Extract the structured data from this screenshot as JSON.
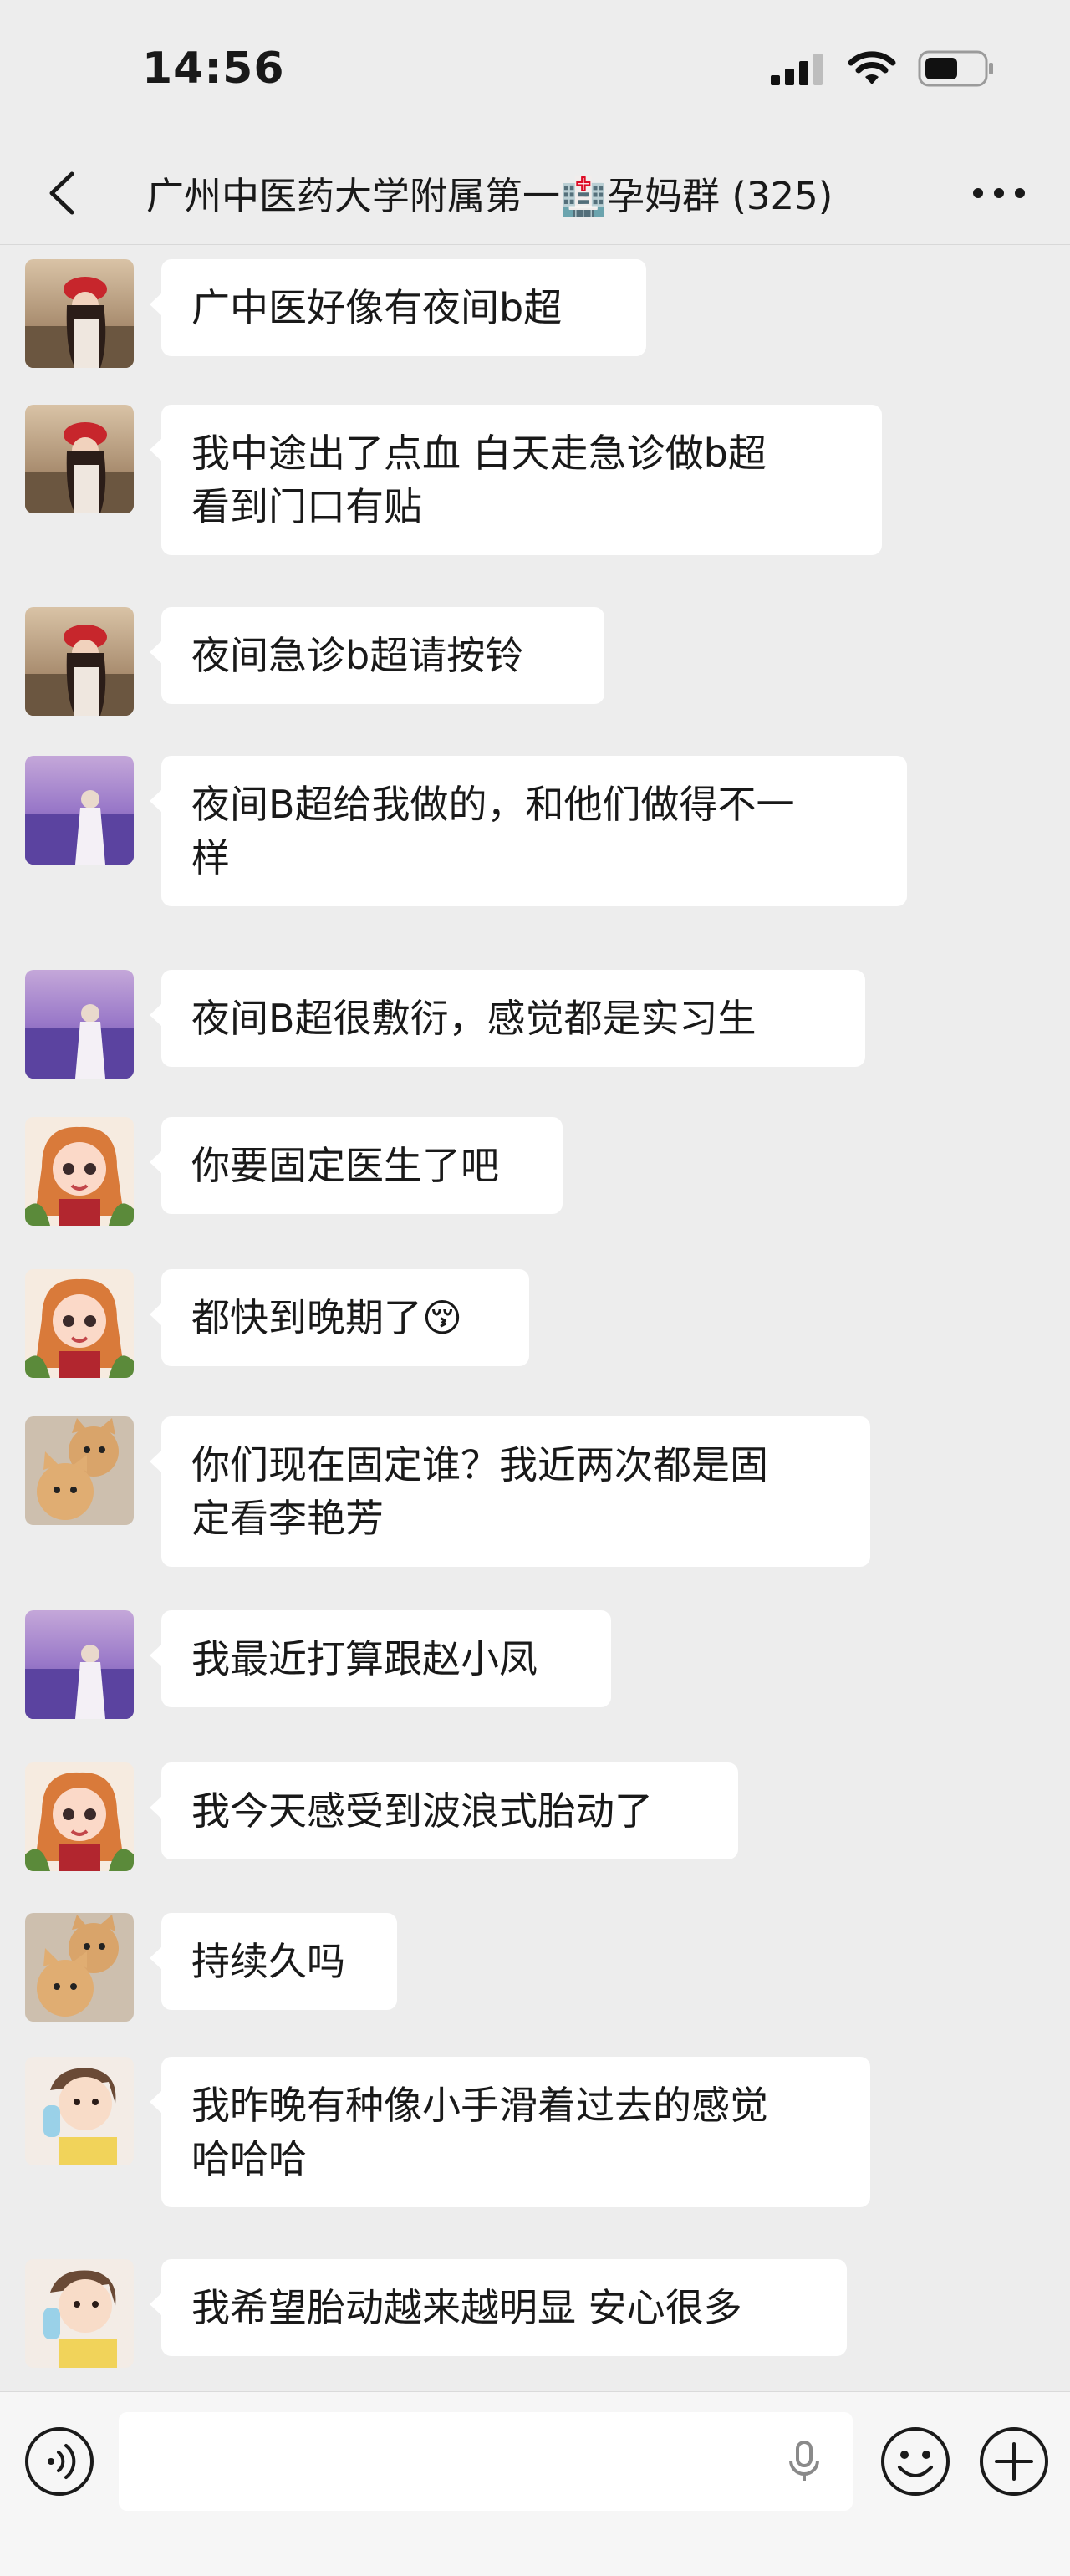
{
  "status_bar": {
    "time": "14:56"
  },
  "header": {
    "title": "广州中医药大学附属第一🏥孕妈群 (325)"
  },
  "messages": [
    {
      "avatar": "red-beret-girl-avatar",
      "lines": [
        "广中医好像有夜间b超"
      ]
    },
    {
      "avatar": "red-beret-girl-avatar",
      "lines": [
        "我中途出了点血  白天走急诊做b超",
        "看到门口有贴"
      ]
    },
    {
      "avatar": "red-beret-girl-avatar",
      "lines": [
        "夜间急诊b超请按铃"
      ]
    },
    {
      "avatar": "lavender-field-avatar",
      "lines": [
        "夜间B超给我做的，和他们做得不一",
        "样"
      ]
    },
    {
      "avatar": "lavender-field-avatar",
      "lines": [
        "夜间B超很敷衍，感觉都是实习生"
      ]
    },
    {
      "avatar": "cartoon-girl-avatar",
      "lines": [
        "你要固定医生了吧"
      ]
    },
    {
      "avatar": "cartoon-girl-avatar",
      "lines": [
        "都快到晚期了😚"
      ]
    },
    {
      "avatar": "cats-avatar",
      "lines": [
        "你们现在固定谁？我近两次都是固",
        "定看李艳芳"
      ]
    },
    {
      "avatar": "lavender-field-avatar",
      "lines": [
        "我最近打算跟赵小凤"
      ]
    },
    {
      "avatar": "cartoon-girl-avatar",
      "lines": [
        "我今天感受到波浪式胎动了"
      ]
    },
    {
      "avatar": "cats-avatar",
      "lines": [
        "持续久吗"
      ]
    },
    {
      "avatar": "baby-girl-avatar",
      "lines": [
        "我昨晚有种像小手滑着过去的感觉",
        "哈哈哈"
      ]
    },
    {
      "avatar": "baby-girl-avatar",
      "lines": [
        "我希望胎动越来越明显  安心很多"
      ]
    }
  ],
  "input_bar": {
    "voice_icon": "voice-icon",
    "mic_icon": "microphone-icon",
    "emoji_icon": "emoji-icon",
    "plus_icon": "plus-icon"
  }
}
